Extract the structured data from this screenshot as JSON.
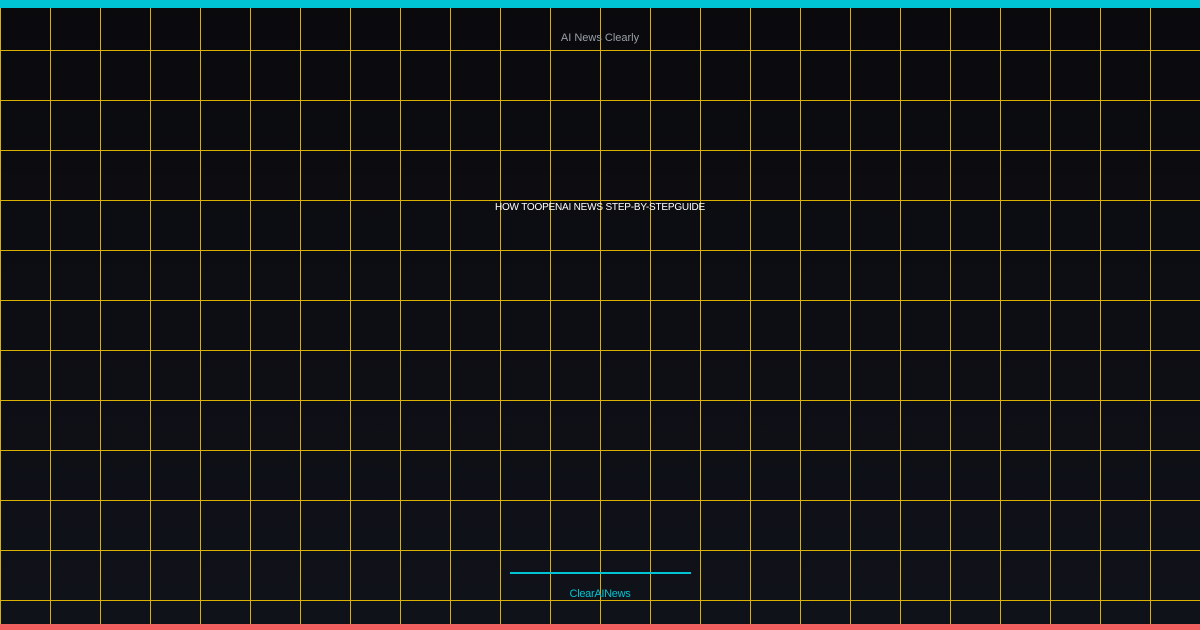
{
  "brand": {
    "name": "AI News Clearly"
  },
  "article": {
    "headline": "HOW TOOPENAI NEWS STEP-BY-STEPGUIDE"
  },
  "footer": {
    "handle": "ClearAINews"
  },
  "colors": {
    "accent": "#00c4d4",
    "grid": "#f2c300",
    "bottom_bar": "#f06060",
    "background": "#0d0e12"
  }
}
